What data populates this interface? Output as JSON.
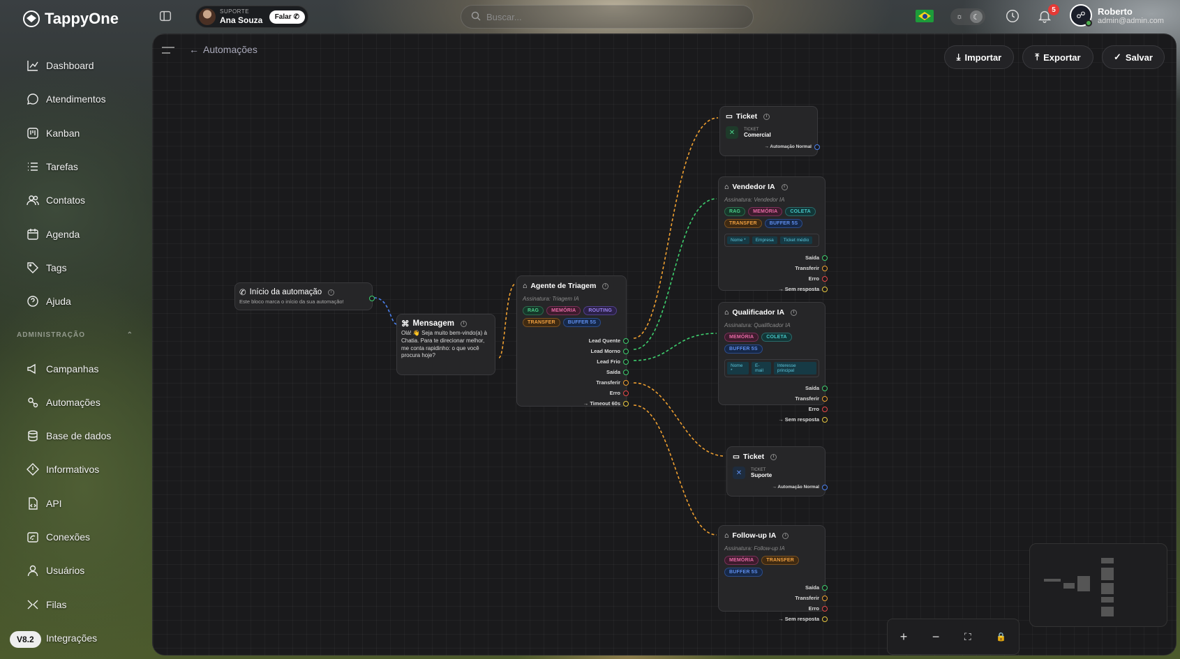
{
  "app": {
    "name": "TappyOne"
  },
  "support": {
    "label": "SUPORTE",
    "name": "Ana Souza",
    "button": "Falar"
  },
  "search": {
    "placeholder": "Buscar..."
  },
  "notifications": {
    "count": "5"
  },
  "user": {
    "name": "Roberto",
    "email": "admin@admin.com"
  },
  "sidebar": {
    "items": [
      {
        "label": "Dashboard",
        "icon": "chart-line-icon"
      },
      {
        "label": "Atendimentos",
        "icon": "chat-icon"
      },
      {
        "label": "Kanban",
        "icon": "kanban-icon"
      },
      {
        "label": "Tarefas",
        "icon": "list-icon"
      },
      {
        "label": "Contatos",
        "icon": "users-icon"
      },
      {
        "label": "Agenda",
        "icon": "calendar-icon"
      },
      {
        "label": "Tags",
        "icon": "tag-icon"
      },
      {
        "label": "Ajuda",
        "icon": "help-icon"
      }
    ],
    "admin_title": "ADMINISTRAÇÃO",
    "admin_items": [
      {
        "label": "Campanhas",
        "icon": "megaphone-icon"
      },
      {
        "label": "Automações",
        "icon": "automation-icon"
      },
      {
        "label": "Base de dados",
        "icon": "database-icon"
      },
      {
        "label": "Informativos",
        "icon": "info-icon"
      },
      {
        "label": "API",
        "icon": "api-file-icon"
      },
      {
        "label": "Conexões",
        "icon": "connection-icon"
      },
      {
        "label": "Usuários",
        "icon": "user-icon"
      },
      {
        "label": "Filas",
        "icon": "queue-icon"
      },
      {
        "label": "Integrações",
        "icon": "integration-icon"
      }
    ],
    "version": "V8.2"
  },
  "page": {
    "breadcrumb": "Automações",
    "buttons": {
      "import": "Importar",
      "export": "Exportar",
      "save": "Salvar"
    }
  },
  "nodes": {
    "start": {
      "title": "Início da automação",
      "desc": "Este bloco marca o início da sua automação!"
    },
    "message": {
      "title": "Mensagem",
      "text": "Olá! 👋 Seja muito bem-vindo(a) à Chatia. Para te direcionar melhor, me conta rapidinho: o que você procura hoje?"
    },
    "triage": {
      "title": "Agente de Triagem",
      "signature": "Assinatura: Triagem IA",
      "tags": [
        "RAG",
        "MEMÓRIA",
        "ROUTING",
        "TRANSFER",
        "BUFFER 5S"
      ],
      "outputs": [
        "Lead Quente",
        "Lead Morno",
        "Lead Frio",
        "Saída",
        "Transferir",
        "Erro",
        "→ Timeout 60s"
      ]
    },
    "ticket1": {
      "title": "Ticket",
      "small": "TICKET",
      "value": "Comercial",
      "output": "→ Automação Normal"
    },
    "seller": {
      "title": "Vendedor IA",
      "signature": "Assinatura: Vendedor IA",
      "tags": [
        "RAG",
        "MEMÓRIA",
        "COLETA",
        "TRANSFER",
        "BUFFER 5S"
      ],
      "fields": [
        "Nome *",
        "Empresa",
        "Ticket médio"
      ],
      "outputs": [
        "Saída",
        "Transferir",
        "Erro",
        "→ Sem resposta"
      ]
    },
    "qualifier": {
      "title": "Qualificador IA",
      "signature": "Assinatura: Qualificador IA",
      "tags": [
        "MEMÓRIA",
        "COLETA",
        "BUFFER 5S"
      ],
      "fields": [
        "Nome *",
        "E-mail",
        "Interesse principal"
      ],
      "outputs": [
        "Saída",
        "Transferir",
        "Erro",
        "→ Sem resposta"
      ]
    },
    "ticket2": {
      "title": "Ticket",
      "small": "TICKET",
      "value": "Suporte",
      "output": "→ Automação Normal"
    },
    "followup": {
      "title": "Follow-up IA",
      "signature": "Assinatura: Follow-up IA",
      "tags": [
        "MEMÓRIA",
        "TRANSFER",
        "BUFFER 5S"
      ],
      "outputs": [
        "Saída",
        "Transferir",
        "Erro",
        "→ Sem resposta"
      ]
    }
  },
  "zoom_controls": [
    "+",
    "−",
    "⛶",
    "🔒"
  ],
  "colors": {
    "accent_orange": "#f0a030",
    "accent_green": "#3ecf6e",
    "panel": "#1a1a1c"
  }
}
